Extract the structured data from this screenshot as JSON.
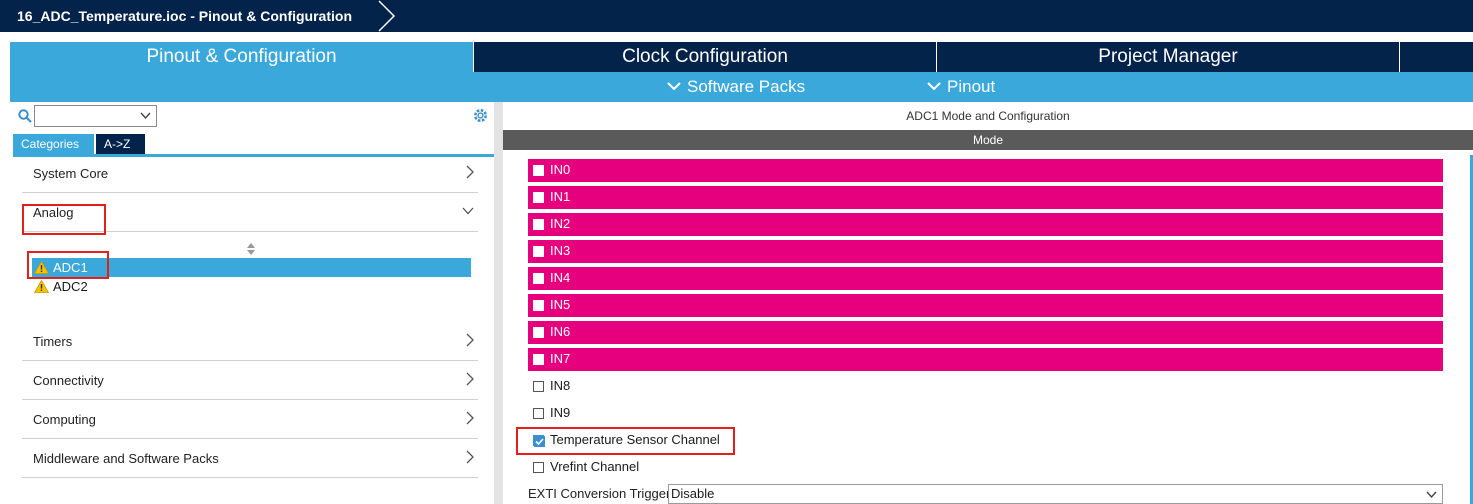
{
  "titlebar": {
    "breadcrumb": "16_ADC_Temperature.ioc - Pinout & Configuration"
  },
  "main_tabs": [
    {
      "label": "Pinout & Configuration",
      "active": true
    },
    {
      "label": "Clock Configuration",
      "active": false
    },
    {
      "label": "Project Manager",
      "active": false
    }
  ],
  "sub_menu": [
    {
      "label": "Software Packs"
    },
    {
      "label": "Pinout"
    }
  ],
  "left_panel": {
    "search_value": "",
    "category_tabs": [
      {
        "label": "Categories",
        "active": true
      },
      {
        "label": "A->Z",
        "active": false
      }
    ],
    "categories": [
      {
        "label": "System Core",
        "expanded": false
      },
      {
        "label": "Analog",
        "expanded": true
      },
      {
        "label": "Timers",
        "expanded": false
      },
      {
        "label": "Connectivity",
        "expanded": false
      },
      {
        "label": "Computing",
        "expanded": false
      },
      {
        "label": "Middleware and Software Packs",
        "expanded": false
      }
    ],
    "analog_items": [
      {
        "label": "ADC1",
        "selected": true,
        "icon": "warning-icon"
      },
      {
        "label": "ADC2",
        "selected": false,
        "icon": "warning-icon"
      }
    ]
  },
  "right_panel": {
    "title": "ADC1 Mode and Configuration",
    "mode_header": "Mode",
    "channels": [
      {
        "label": "IN0",
        "checked": false,
        "highlight": true
      },
      {
        "label": "IN1",
        "checked": false,
        "highlight": true
      },
      {
        "label": "IN2",
        "checked": false,
        "highlight": true
      },
      {
        "label": "IN3",
        "checked": false,
        "highlight": true
      },
      {
        "label": "IN4",
        "checked": false,
        "highlight": true
      },
      {
        "label": "IN5",
        "checked": false,
        "highlight": true
      },
      {
        "label": "IN6",
        "checked": false,
        "highlight": true
      },
      {
        "label": "IN7",
        "checked": false,
        "highlight": true
      },
      {
        "label": "IN8",
        "checked": false,
        "highlight": false
      },
      {
        "label": "IN9",
        "checked": false,
        "highlight": false
      },
      {
        "label": "Temperature Sensor Channel",
        "checked": true,
        "highlight": false
      },
      {
        "label": "Vrefint Channel",
        "checked": false,
        "highlight": false
      }
    ],
    "exti_label": "EXTI Conversion Trigger",
    "exti_value": "Disable"
  },
  "colors": {
    "navy": "#03234b",
    "accent_blue": "#3aa8db",
    "pin_pink": "#e6007e",
    "annotation_red": "#e0211b"
  }
}
